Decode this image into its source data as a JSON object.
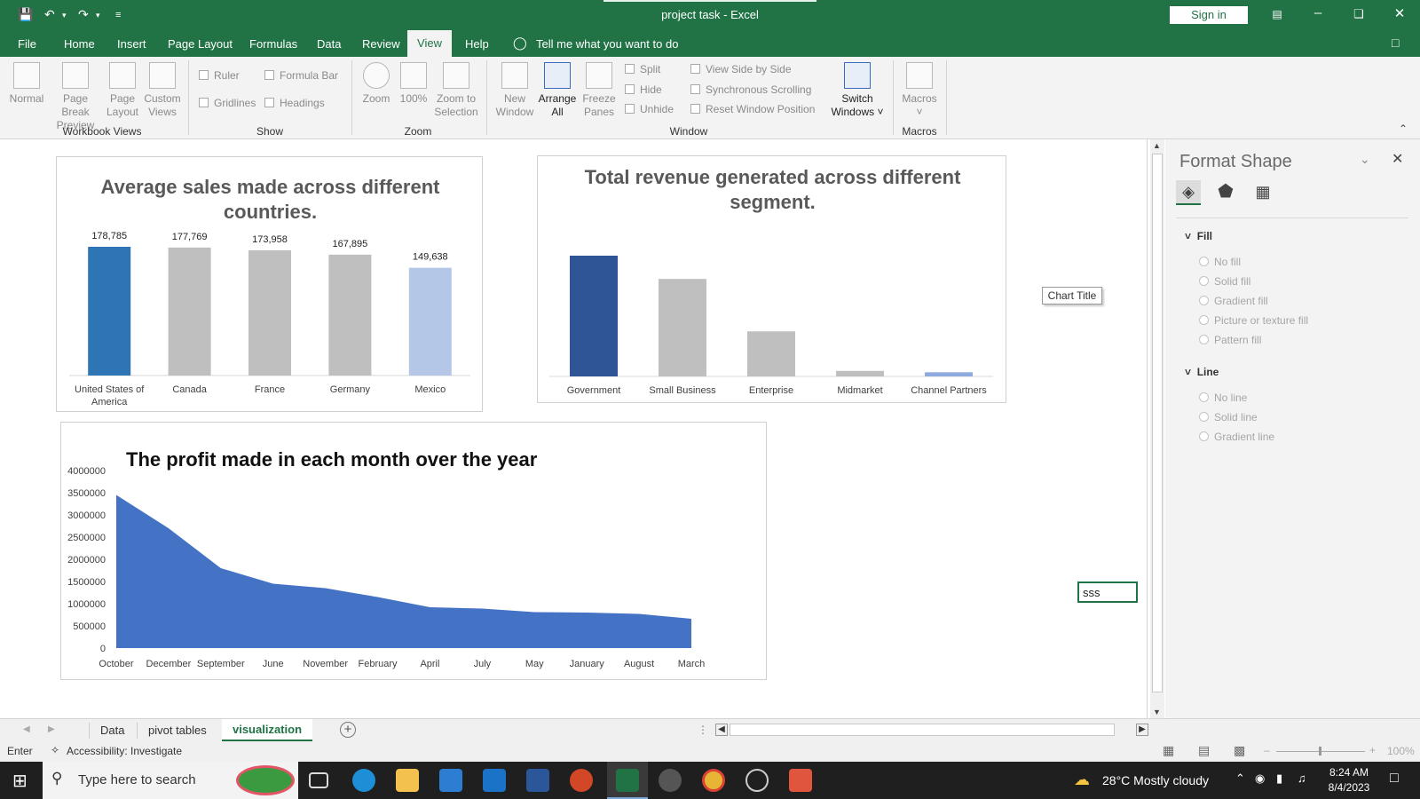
{
  "window": {
    "title": "project task  -  Excel",
    "sign_in": "Sign in"
  },
  "menu": [
    "File",
    "Home",
    "Insert",
    "Page Layout",
    "Formulas",
    "Data",
    "Review",
    "View",
    "Help"
  ],
  "tell_me": "Tell me what you want to do",
  "ribbon": {
    "workbook_views": {
      "label": "Workbook Views",
      "normal": "Normal",
      "page_break_1": "Page Break",
      "page_break_2": "Preview",
      "page_layout_1": "Page",
      "page_layout_2": "Layout",
      "custom_1": "Custom",
      "custom_2": "Views"
    },
    "show": {
      "label": "Show",
      "ruler": "Ruler",
      "formula_bar": "Formula Bar",
      "gridlines": "Gridlines",
      "headings": "Headings"
    },
    "zoom": {
      "label": "Zoom",
      "zoom": "Zoom",
      "hundred": "100%",
      "zoom_sel_1": "Zoom to",
      "zoom_sel_2": "Selection"
    },
    "window": {
      "label": "Window",
      "new_1": "New",
      "new_2": "Window",
      "arrange_1": "Arrange",
      "arrange_2": "All",
      "freeze_1": "Freeze",
      "freeze_2": "Panes",
      "split": "Split",
      "hide": "Hide",
      "unhide": "Unhide",
      "side_by_side": "View Side by Side",
      "sync_scroll": "Synchronous Scrolling",
      "reset_pos": "Reset Window Position",
      "switch_1": "Switch",
      "switch_2": "Windows"
    },
    "macros": {
      "label": "Macros",
      "macros": "Macros"
    }
  },
  "charts": {
    "chart_title_tooltip": "Chart Title",
    "cell_value": "sss"
  },
  "chart_data": [
    {
      "type": "bar",
      "title": "Average sales made across different countries.",
      "categories": [
        "United States of America",
        "Canada",
        "France",
        "Germany",
        "Mexico"
      ],
      "values": [
        178785,
        177769,
        173958,
        167895,
        149638
      ],
      "value_labels": [
        "178,785",
        "177,769",
        "173,958",
        "167,895",
        "149,638"
      ],
      "colors": [
        "#2e75b6",
        "#bfbfbf",
        "#bfbfbf",
        "#bfbfbf",
        "#b4c7e7"
      ]
    },
    {
      "type": "bar",
      "title": "Total revenue generated across different segment.",
      "categories": [
        "Government",
        "Small Business",
        "Enterprise",
        "Midmarket",
        "Channel Partners"
      ],
      "values": [
        52500000,
        42400000,
        19600000,
        2400000,
        1800000
      ],
      "colors": [
        "#2f5597",
        "#bfbfbf",
        "#bfbfbf",
        "#bfbfbf",
        "#8faadc"
      ]
    },
    {
      "type": "area",
      "title": "The profit made in each month over the year",
      "categories": [
        "October",
        "December",
        "September",
        "June",
        "November",
        "February",
        "April",
        "July",
        "May",
        "January",
        "August",
        "March"
      ],
      "values": [
        3450000,
        2700000,
        1800000,
        1450000,
        1350000,
        1150000,
        920000,
        890000,
        810000,
        800000,
        770000,
        660000
      ],
      "ylim": [
        0,
        4000000
      ],
      "yticks": [
        "4000000",
        "3500000",
        "3000000",
        "2500000",
        "2000000",
        "1500000",
        "1000000",
        "500000",
        "0"
      ],
      "color": "#4472c4"
    }
  ],
  "format_pane": {
    "title": "Format Shape",
    "fill_header": "Fill",
    "fill_options": [
      "No fill",
      "Solid fill",
      "Gradient fill",
      "Picture or texture fill",
      "Pattern fill"
    ],
    "line_header": "Line",
    "line_options": [
      "No line",
      "Solid line",
      "Gradient line"
    ]
  },
  "tabs": [
    "Data",
    "pivot tables",
    "visualization"
  ],
  "status": {
    "mode": "Enter",
    "accessibility": "Accessibility: Investigate",
    "zoom": "100%"
  },
  "taskbar": {
    "search_placeholder": "Type here to search",
    "weather": "28°C  Mostly cloudy",
    "time": "8:24 AM",
    "date": "8/4/2023"
  }
}
